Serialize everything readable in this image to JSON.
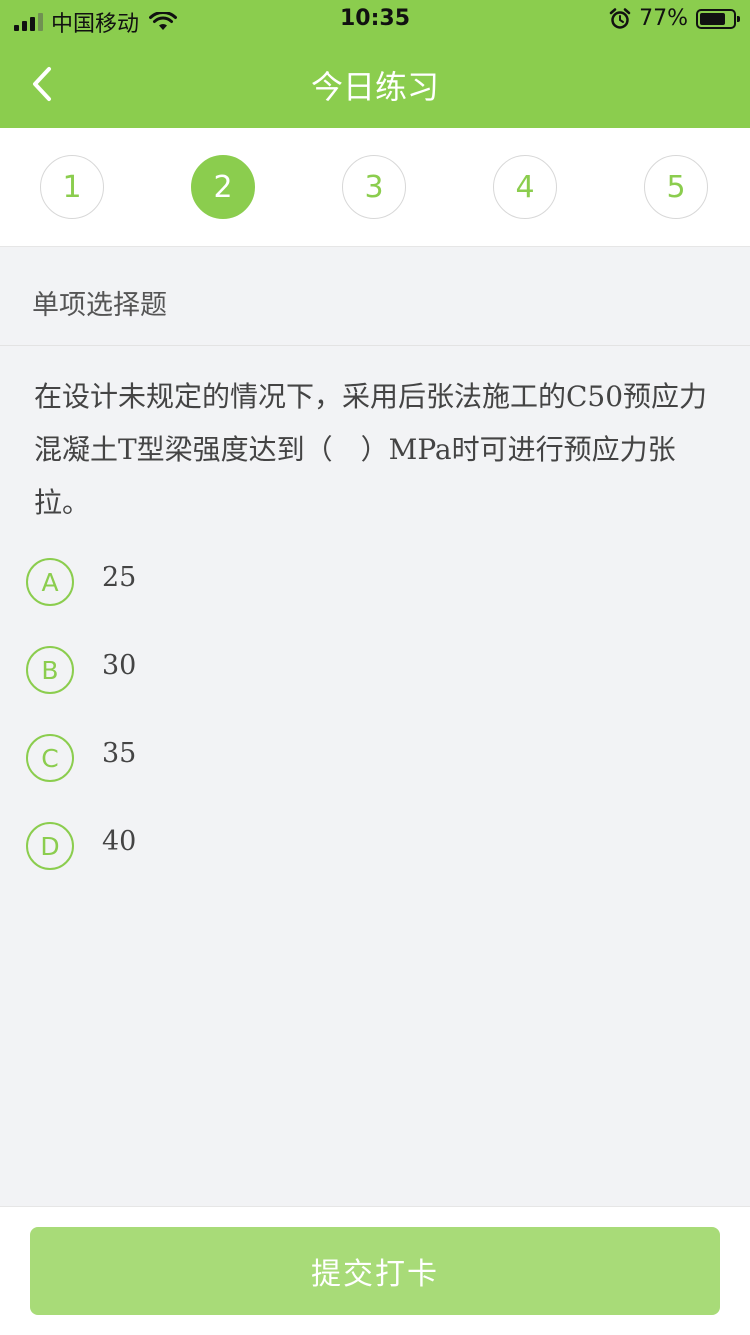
{
  "status_bar": {
    "carrier": "中国移动",
    "time": "10:35",
    "battery_percent": "77%",
    "battery_level": 0.77,
    "signal_bars": 4,
    "icons": [
      "signal-icon",
      "wifi-icon",
      "alarm-icon",
      "battery-icon"
    ]
  },
  "nav": {
    "back_icon": "chevron-left-icon",
    "title": "今日练习"
  },
  "tabs": [
    {
      "label": "1",
      "active": false
    },
    {
      "label": "2",
      "active": true
    },
    {
      "label": "3",
      "active": false
    },
    {
      "label": "4",
      "active": false
    },
    {
      "label": "5",
      "active": false
    }
  ],
  "section": {
    "title": "单项选择题"
  },
  "question": {
    "text": "在设计未规定的情况下，采用后张法施工的C50预应力混凝土T型梁强度达到（　）MPa时可进行预应力张拉。"
  },
  "options": [
    {
      "letter": "A",
      "text": "25"
    },
    {
      "letter": "B",
      "text": "30"
    },
    {
      "letter": "C",
      "text": "35"
    },
    {
      "letter": "D",
      "text": "40"
    }
  ],
  "submit": {
    "label": "提交打卡"
  },
  "colors": {
    "accent": "#8bcd4e",
    "submit_disabled": "#a8db78",
    "background": "#f2f3f5"
  }
}
